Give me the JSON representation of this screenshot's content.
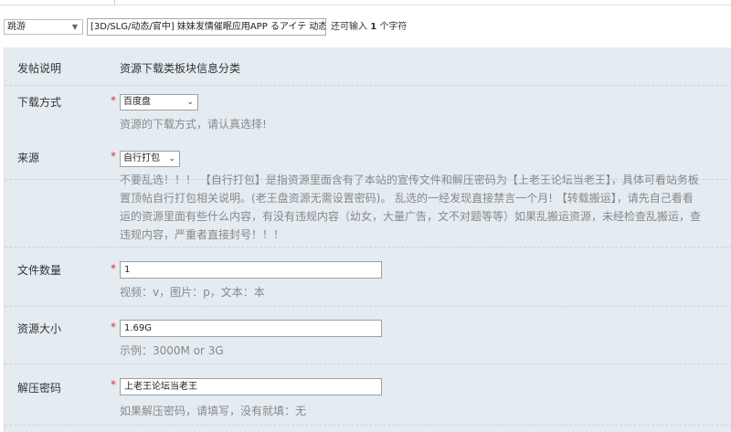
{
  "title_bar": {
    "type_select": "跳游",
    "title_value": "[3D/SLG/动态/官中] 妹妹发情催眠应用APP るアイテ  动态",
    "char_hint_prefix": "还可输入",
    "char_hint_count": "1",
    "char_hint_suffix": "个字符"
  },
  "form": {
    "notice": {
      "label": "发帖说明",
      "value": "资源下载类板块信息分类"
    },
    "download_method": {
      "label": "下载方式",
      "star": "*",
      "selected": "百度盘",
      "hint": "资源的下载方式，请认真选择!"
    },
    "source": {
      "label": "来源",
      "star": "*",
      "selected": "自行打包",
      "desc_lines": [
        "不要乱选！！！  【自行打包】是指资源里面含有了本站的宣传文件和解压密码为【上老王论坛当老王】，具体可看站务板",
        "置顶帖自行打包相关说明。(老王盘资源无需设置密码)。 乱选的一经发现直接禁言一个月!  【转载搬运】，请先自己看看",
        "运的资源里面有些什么内容，有没有违规内容（幼女，大量广告，文不对题等等）如果乱搬运资源，未经检查乱搬运，查",
        "违规内容，严重者直接封号！！！"
      ]
    },
    "file_count": {
      "label": "文件数量",
      "star": "*",
      "value": "1",
      "hint": "视频：v，图片：p，文本：本"
    },
    "size": {
      "label": "资源大小",
      "star": "*",
      "value": "1.69G",
      "hint": "示例：3000M or 3G"
    },
    "password": {
      "label": "解压密码",
      "star": "*",
      "value": "上老王论坛当老王",
      "hint": "如果解压密码，请填写，没有就填：无"
    }
  }
}
